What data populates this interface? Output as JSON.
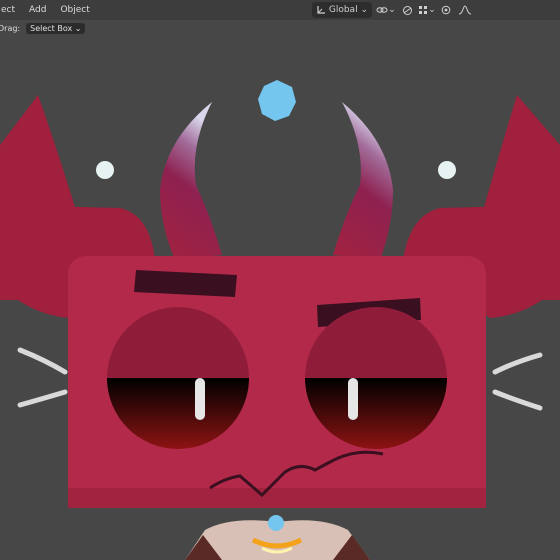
{
  "header": {
    "menu": [
      "ect",
      "Add",
      "Object"
    ],
    "orientation": "Global",
    "drag_label": "Drag:",
    "select_mode": "Select Box"
  },
  "icons": {
    "orientation": "transform-orientation-icon",
    "pivot": "link-icon",
    "snap": "snap-icon",
    "proportional": "proportional-editing-icon",
    "falloff": "falloff-curve-icon"
  },
  "colors": {
    "viewport": "#474747",
    "face": "#b3294a",
    "horns_dark": "#7b1f3a",
    "accent_blue": "#74c6ee"
  }
}
